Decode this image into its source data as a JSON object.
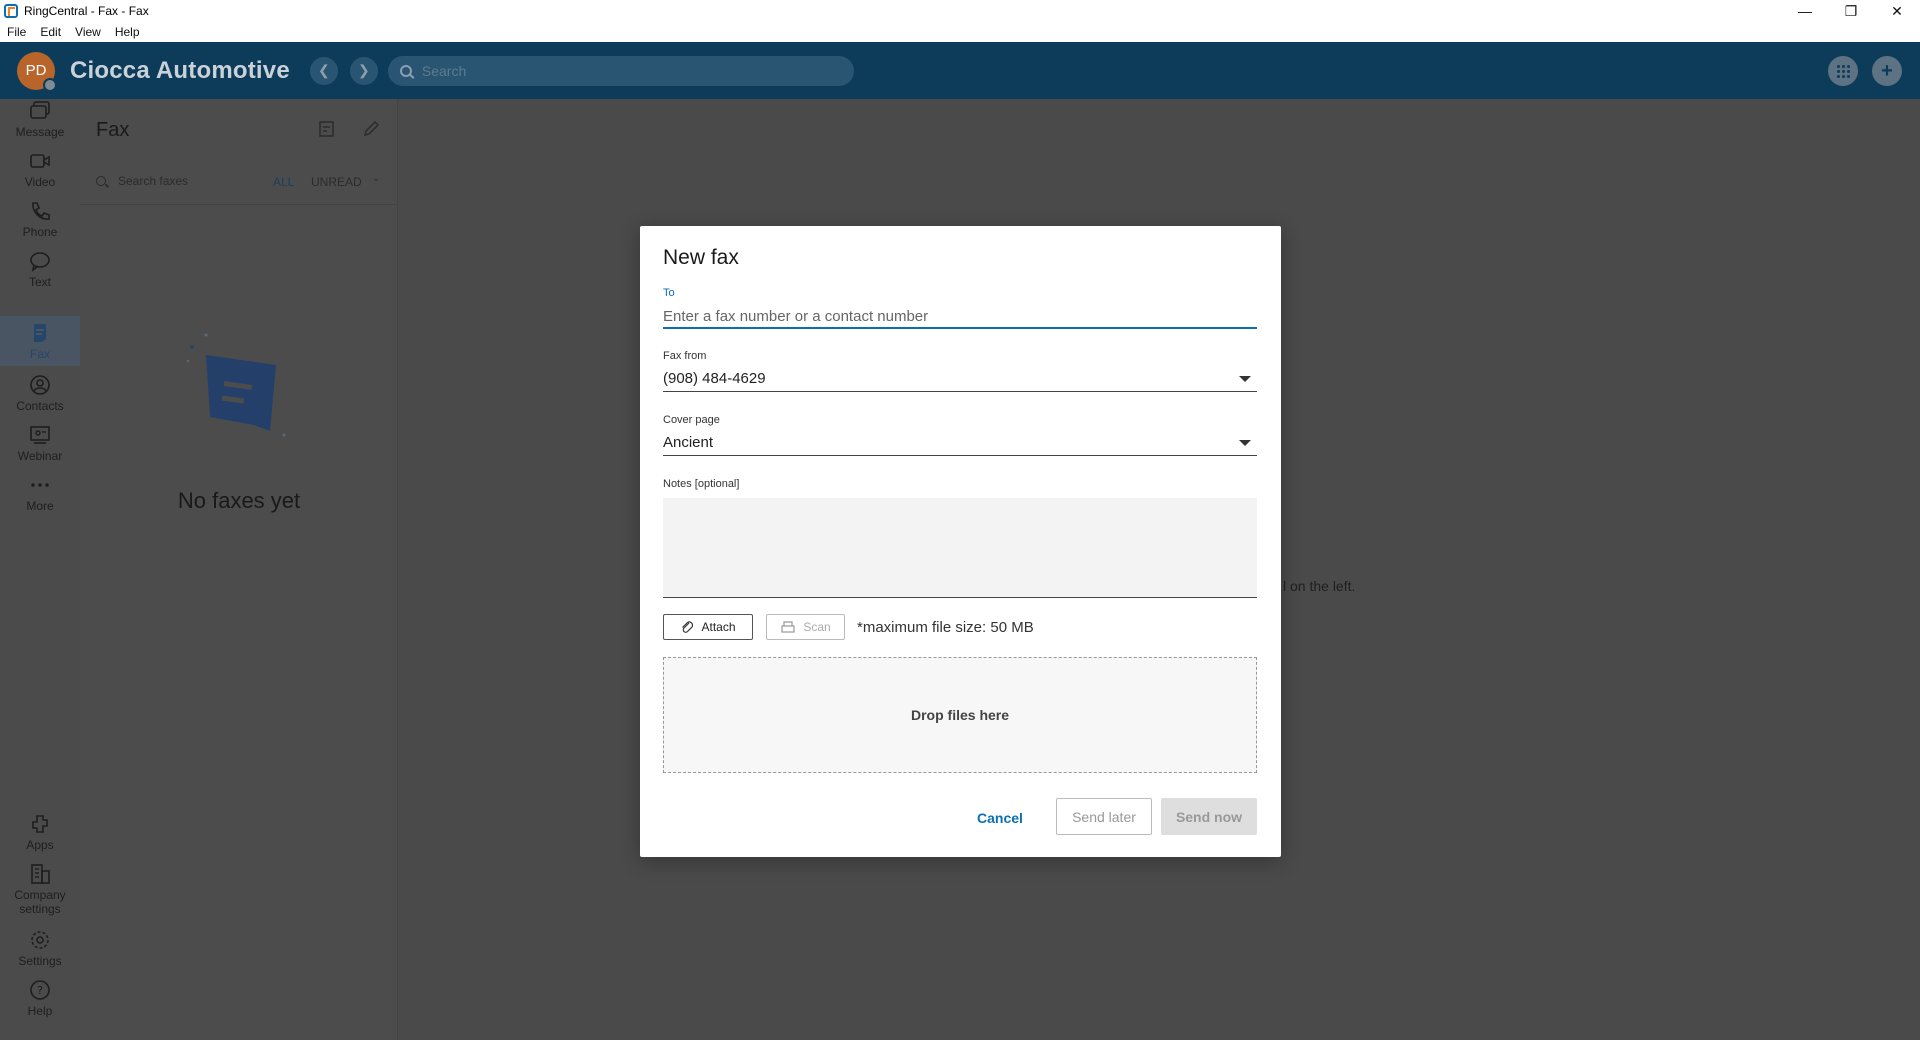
{
  "window": {
    "title": "RingCentral - Fax - Fax",
    "controls": [
      "—",
      "❐",
      "✕"
    ]
  },
  "menu": [
    "File",
    "Edit",
    "View",
    "Help"
  ],
  "header": {
    "avatar_initials": "PD",
    "company": "Ciocca Automotive",
    "search_placeholder": "Search"
  },
  "leftnav": {
    "items": [
      {
        "label": "Message",
        "icon": "message-icon"
      },
      {
        "label": "Video",
        "icon": "video-icon"
      },
      {
        "label": "Phone",
        "icon": "phone-icon"
      },
      {
        "label": "Text",
        "icon": "text-icon"
      },
      {
        "label": "Fax",
        "icon": "fax-icon",
        "active": true
      },
      {
        "label": "Contacts",
        "icon": "contacts-icon"
      },
      {
        "label": "Webinar",
        "icon": "webinar-icon"
      },
      {
        "label": "More",
        "icon": "more-icon"
      }
    ],
    "bottom_items": [
      {
        "label": "Apps",
        "icon": "apps-icon"
      },
      {
        "label": "Company settings",
        "icon": "company-settings-icon"
      },
      {
        "label": "Settings",
        "icon": "settings-icon"
      },
      {
        "label": "Help",
        "icon": "help-icon"
      }
    ]
  },
  "listpane": {
    "title": "Fax",
    "search_placeholder": "Search faxes",
    "filter_all": "ALL",
    "filter_unread": "UNREAD",
    "empty_text": "No faxes yet"
  },
  "main": {
    "hint_fragment": "l on the left."
  },
  "dialog": {
    "title": "New fax",
    "to_label": "To",
    "to_placeholder": "Enter a fax number or a contact number",
    "fax_from_label": "Fax from",
    "fax_from_value": "(908) 484-4629",
    "cover_page_label": "Cover page",
    "cover_page_value": "Ancient",
    "notes_label": "Notes [optional]",
    "attach_label": "Attach",
    "scan_label": "Scan",
    "max_size_text": "*maximum file size: 50 MB",
    "dropzone_text": "Drop files here",
    "cancel_label": "Cancel",
    "send_later_label": "Send later",
    "send_now_label": "Send now"
  },
  "colors": {
    "header_bg": "#0d3b5a",
    "accent": "#0a6fb5",
    "overlay_bg": "#4a4a4a"
  }
}
